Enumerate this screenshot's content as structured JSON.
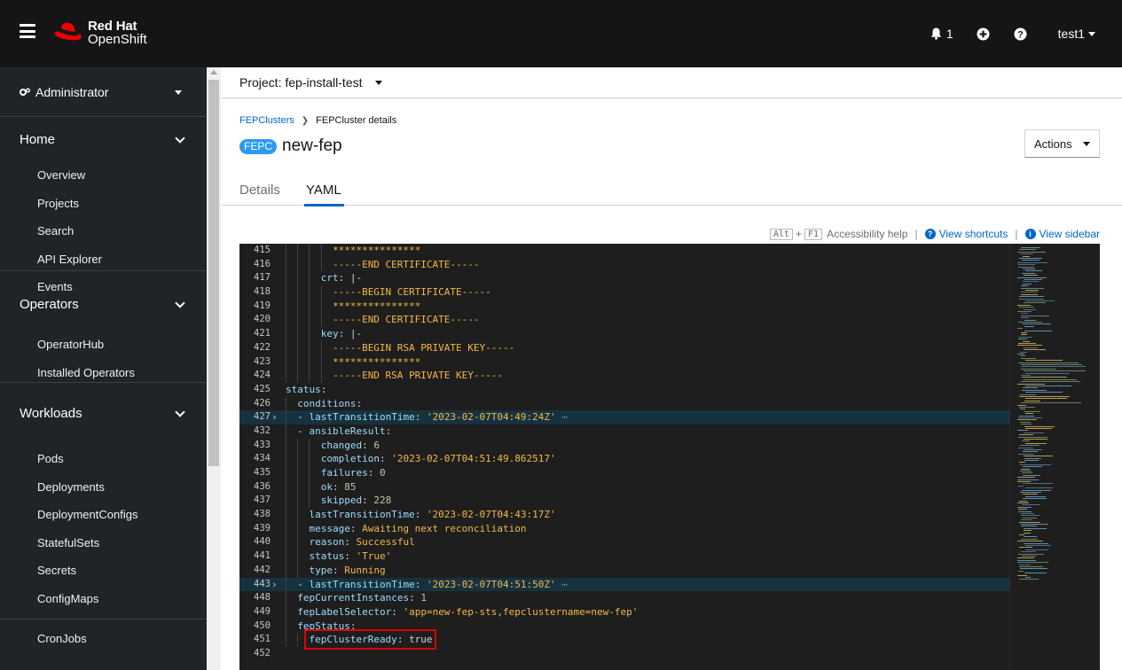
{
  "masthead": {
    "brand_top": "Red Hat",
    "brand_bottom": "OpenShift",
    "notifications_count": "1",
    "user": "test1"
  },
  "sidebar": {
    "perspective": "Administrator",
    "sections": [
      {
        "title": "Home",
        "items": [
          "Overview",
          "Projects",
          "Search",
          "API Explorer",
          "Events"
        ]
      },
      {
        "title": "Operators",
        "items": [
          "OperatorHub",
          "Installed Operators"
        ]
      },
      {
        "title": "Workloads",
        "items": [
          "Pods",
          "Deployments",
          "DeploymentConfigs",
          "StatefulSets",
          "Secrets",
          "ConfigMaps",
          "CronJobs"
        ]
      }
    ]
  },
  "project_bar": {
    "label": "Project: fep-install-test"
  },
  "breadcrumb": {
    "parent": "FEPClusters",
    "current": "FEPCluster details"
  },
  "resource": {
    "badge": "FEPC",
    "name": "new-fep"
  },
  "actions_label": "Actions",
  "tabs": {
    "details": "Details",
    "yaml": "YAML"
  },
  "help_bar": {
    "key1": "Alt",
    "plus": "+",
    "key2": "F1",
    "accessibility": "Accessibility help",
    "separator": "|",
    "view_shortcuts": "View shortcuts",
    "view_sidebar": "View sidebar"
  },
  "editor": {
    "lines": [
      {
        "n": "415",
        "i": 4,
        "t": [
          [
            "s",
            "***************"
          ]
        ]
      },
      {
        "n": "416",
        "i": 4,
        "t": [
          [
            "s",
            "-----END CERTIFICATE-----"
          ]
        ]
      },
      {
        "n": "417",
        "i": 3,
        "t": [
          [
            "k",
            "crt"
          ],
          [
            "o",
            ": |-"
          ]
        ]
      },
      {
        "n": "418",
        "i": 4,
        "t": [
          [
            "s",
            "-----BEGIN CERTIFICATE-----"
          ]
        ]
      },
      {
        "n": "419",
        "i": 4,
        "t": [
          [
            "s",
            "***************"
          ]
        ]
      },
      {
        "n": "420",
        "i": 4,
        "t": [
          [
            "s",
            "-----END CERTIFICATE-----"
          ]
        ]
      },
      {
        "n": "421",
        "i": 3,
        "t": [
          [
            "k",
            "key"
          ],
          [
            "o",
            ": |-"
          ]
        ]
      },
      {
        "n": "422",
        "i": 4,
        "t": [
          [
            "s",
            "-----BEGIN RSA PRIVATE KEY-----"
          ]
        ]
      },
      {
        "n": "423",
        "i": 4,
        "t": [
          [
            "s",
            "***************"
          ]
        ]
      },
      {
        "n": "424",
        "i": 4,
        "t": [
          [
            "s",
            "-----END RSA PRIVATE KEY-----"
          ]
        ]
      },
      {
        "n": "425",
        "i": 0,
        "t": [
          [
            "k",
            "status"
          ],
          [
            "o",
            ":"
          ]
        ]
      },
      {
        "n": "426",
        "i": 1,
        "t": [
          [
            "k",
            "conditions"
          ],
          [
            "o",
            ":"
          ]
        ]
      },
      {
        "n": "427",
        "i": 1,
        "hl": true,
        "fold": true,
        "t": [
          [
            "o",
            "- "
          ],
          [
            "k",
            "lastTransitionTime"
          ],
          [
            "o",
            ": "
          ],
          [
            "s",
            "'2023-02-07T04:49:24Z'"
          ],
          [
            "e",
            " ⋯"
          ]
        ]
      },
      {
        "n": "432",
        "i": 1,
        "t": [
          [
            "o",
            "- "
          ],
          [
            "k",
            "ansibleResult"
          ],
          [
            "o",
            ":"
          ]
        ]
      },
      {
        "n": "433",
        "i": 3,
        "t": [
          [
            "k",
            "changed"
          ],
          [
            "o",
            ": "
          ],
          [
            "n",
            "6"
          ]
        ]
      },
      {
        "n": "434",
        "i": 3,
        "t": [
          [
            "k",
            "completion"
          ],
          [
            "o",
            ": "
          ],
          [
            "s",
            "'2023-02-07T04:51:49.862517'"
          ]
        ]
      },
      {
        "n": "435",
        "i": 3,
        "t": [
          [
            "k",
            "failures"
          ],
          [
            "o",
            ": "
          ],
          [
            "n",
            "0"
          ]
        ]
      },
      {
        "n": "436",
        "i": 3,
        "t": [
          [
            "k",
            "ok"
          ],
          [
            "o",
            ": "
          ],
          [
            "n",
            "85"
          ]
        ]
      },
      {
        "n": "437",
        "i": 3,
        "t": [
          [
            "k",
            "skipped"
          ],
          [
            "o",
            ": "
          ],
          [
            "n",
            "228"
          ]
        ]
      },
      {
        "n": "438",
        "i": 2,
        "t": [
          [
            "k",
            "lastTransitionTime"
          ],
          [
            "o",
            ": "
          ],
          [
            "s",
            "'2023-02-07T04:43:17Z'"
          ]
        ]
      },
      {
        "n": "439",
        "i": 2,
        "t": [
          [
            "k",
            "message"
          ],
          [
            "o",
            ": "
          ],
          [
            "s",
            "Awaiting next reconciliation"
          ]
        ]
      },
      {
        "n": "440",
        "i": 2,
        "t": [
          [
            "k",
            "reason"
          ],
          [
            "o",
            ": "
          ],
          [
            "s",
            "Successful"
          ]
        ]
      },
      {
        "n": "441",
        "i": 2,
        "t": [
          [
            "k",
            "status"
          ],
          [
            "o",
            ": "
          ],
          [
            "s",
            "'True'"
          ]
        ]
      },
      {
        "n": "442",
        "i": 2,
        "t": [
          [
            "k",
            "type"
          ],
          [
            "o",
            ": "
          ],
          [
            "s",
            "Running"
          ]
        ]
      },
      {
        "n": "443",
        "i": 1,
        "hl": true,
        "fold": true,
        "t": [
          [
            "o",
            "- "
          ],
          [
            "k",
            "lastTransitionTime"
          ],
          [
            "o",
            ": "
          ],
          [
            "s",
            "'2023-02-07T04:51:50Z'"
          ],
          [
            "e",
            " ⋯"
          ]
        ]
      },
      {
        "n": "448",
        "i": 1,
        "t": [
          [
            "k",
            "fepCurrentInstances"
          ],
          [
            "o",
            ": "
          ],
          [
            "n",
            "1"
          ]
        ]
      },
      {
        "n": "449",
        "i": 1,
        "t": [
          [
            "k",
            "fepLabelSelector"
          ],
          [
            "o",
            ": "
          ],
          [
            "s",
            "'app=new-fep-sts,fepclustername=new-fep'"
          ]
        ]
      },
      {
        "n": "450",
        "i": 1,
        "t": [
          [
            "k",
            "fepStatus"
          ],
          [
            "o",
            ":"
          ]
        ]
      },
      {
        "n": "451",
        "i": 2,
        "callout": true,
        "t": [
          [
            "k",
            "fepClusterReady"
          ],
          [
            "o",
            ": "
          ],
          [
            "d",
            "true"
          ]
        ]
      },
      {
        "n": "452",
        "i": 0,
        "t": []
      }
    ]
  },
  "colors": {
    "masthead_bg": "#151515",
    "sidebar_bg": "#212427",
    "link_blue": "#0066cc",
    "badge_blue": "#2b9af3",
    "editor_bg": "#1e1e1e",
    "yaml_key": "#9cdcfe",
    "yaml_string": "#f5b748",
    "yaml_number": "#b5cea8",
    "callout_red": "#e00000",
    "redhat_red": "#ee0000"
  },
  "icons": [
    "hamburger-icon",
    "redhat-logo-icon",
    "bell-icon",
    "plus-circle-icon",
    "help-icon",
    "gear-icon",
    "chevron-down-icon",
    "fold-arrow-icon",
    "info-icon"
  ]
}
